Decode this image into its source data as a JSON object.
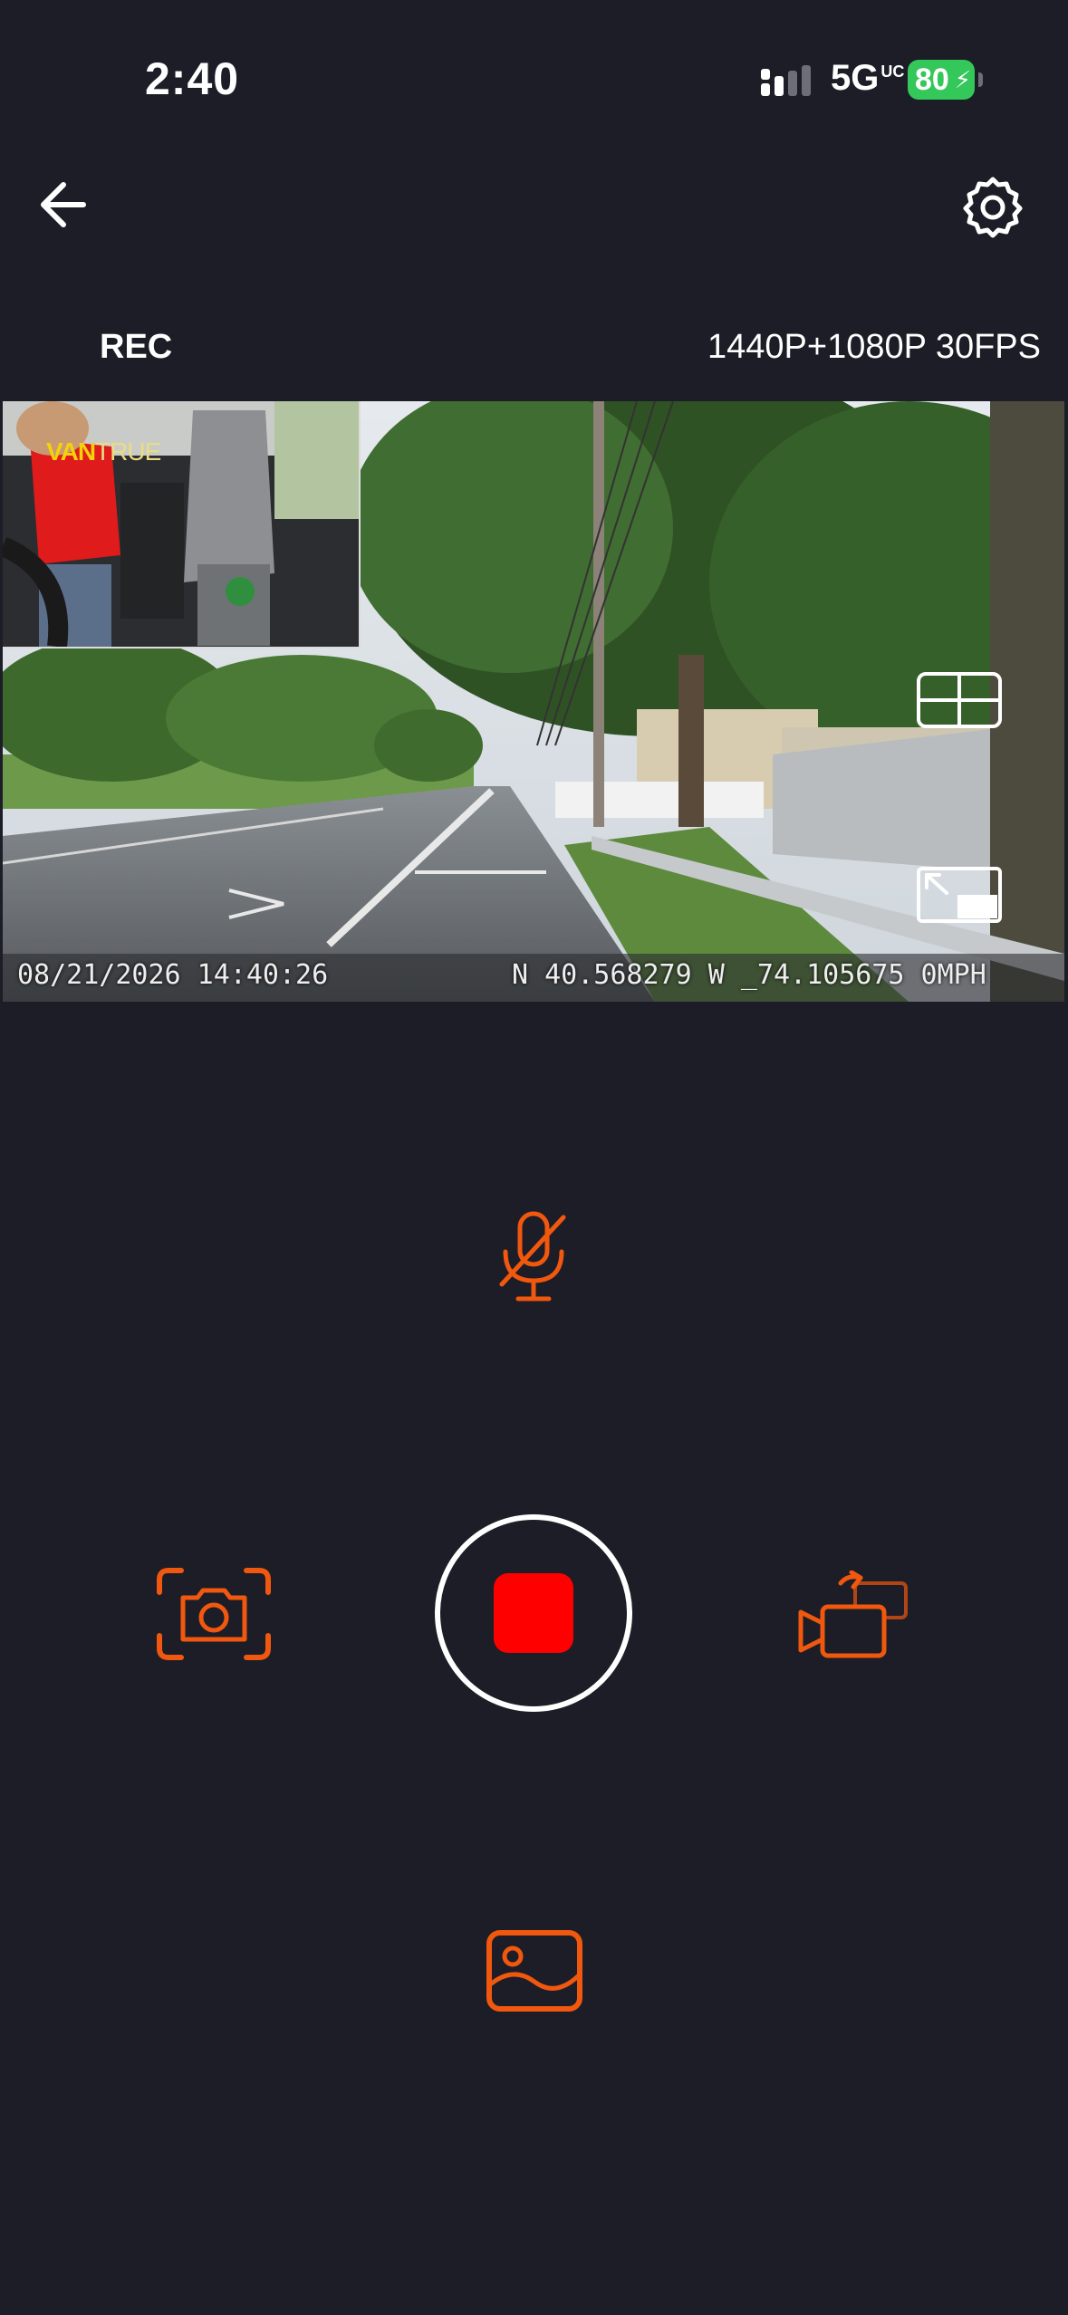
{
  "status_bar": {
    "time": "2:40",
    "network": "5G",
    "network_sup": "UC",
    "battery": "80"
  },
  "header": {
    "back_icon": "arrow-left-icon",
    "settings_icon": "gear-icon"
  },
  "recording": {
    "state_label": "REC",
    "resolution": "1440P+1080P 30FPS"
  },
  "video": {
    "timestamp": "08/21/2026 14:40:26",
    "gps": "N 40.568279 W _74.105675 0MPH",
    "pip_brand_bold": "VAN",
    "pip_brand_thin": "TRUE"
  },
  "controls": {
    "mic_icon": "microphone-muted-icon",
    "snapshot_icon": "camera-capture-icon",
    "record_icon": "stop-record-icon",
    "switch_icon": "switch-camera-icon",
    "gallery_icon": "gallery-icon"
  },
  "colors": {
    "background": "#1c1d26",
    "accent": "#f0570f",
    "record": "#ff0000",
    "battery": "#34c759"
  }
}
